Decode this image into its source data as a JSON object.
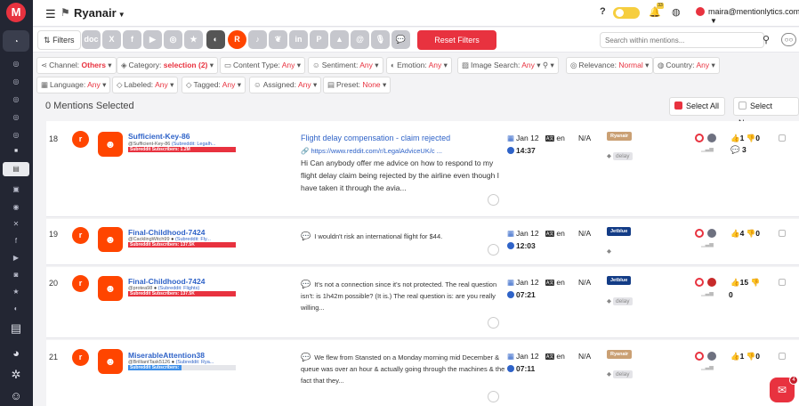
{
  "header": {
    "brand": "Ryanair",
    "help": "?",
    "bell_badge": "33",
    "user_email": "maira@mentionlytics.com"
  },
  "sidebar": {
    "logo": "M",
    "icons": [
      "dashboard-icon",
      "mentions-icon",
      "analytics-icon",
      "reports-icon",
      "chat-icon",
      "inbox-icon",
      "facebook-icon",
      "x-icon",
      "instagram-icon",
      "youtube-icon",
      "tiktok-icon",
      "star-icon",
      "contrast-icon",
      "document-icon",
      "pie-chart-icon",
      "settings-icon",
      "people-icon"
    ]
  },
  "toolbar": {
    "filters_label": "Filters",
    "reset_label": "Reset Filters",
    "search_placeholder": "Search within mentions...",
    "channels": [
      "doc",
      "X",
      "f",
      "▶",
      "◎",
      "★",
      "◐",
      "R",
      "♪",
      "❦",
      "in",
      "P",
      "▲",
      "@",
      "🎙",
      "💬"
    ]
  },
  "filters": {
    "row1": [
      {
        "key": "channel",
        "label": "Channel:",
        "value": "Others",
        "bold": true
      },
      {
        "key": "category",
        "label": "Category:",
        "value": "selection (2)",
        "bold": true
      },
      {
        "key": "content_type",
        "label": "Content Type:",
        "value": "Any"
      },
      {
        "key": "sentiment",
        "label": "Sentiment:",
        "value": "Any"
      },
      {
        "key": "emotion",
        "label": "Emotion:",
        "value": "Any"
      },
      {
        "key": "image_search",
        "label": "Image Search:",
        "value": "Any"
      },
      {
        "key": "relevance",
        "label": "Relevance:",
        "value": "Normal"
      },
      {
        "key": "country",
        "label": "Country:",
        "value": "Any"
      }
    ],
    "row2": [
      {
        "key": "language",
        "label": "Language:",
        "value": "Any"
      },
      {
        "key": "labeled",
        "label": "Labeled:",
        "value": "Any"
      },
      {
        "key": "tagged",
        "label": "Tagged:",
        "value": "Any"
      },
      {
        "key": "assigned",
        "label": "Assigned:",
        "value": "Any"
      },
      {
        "key": "preset",
        "label": "Preset:",
        "value": "None"
      }
    ]
  },
  "selection": {
    "count_text": "0 Mentions Selected",
    "select_all": "Select All",
    "select_none": "Select None"
  },
  "mentions": [
    {
      "num": "18",
      "username": "Sufficient-Key-86",
      "handle": "@Sufficient-Key-86",
      "subreddit": "(Subreddit: Legalh...",
      "subscribers": "Subreddit Subscribers: 1.2M",
      "title": "Flight delay compensation - claim rejected",
      "link": "https://www.reddit.com/r/LegalAdviceUK/c ...",
      "text": "Hi Can anybody offer me advice on how to respond to my flight delay claim being rejected by the airline even though I have taken it through the avia...",
      "date": "Jan 12",
      "time": "14:37",
      "lang": "en",
      "country": "N/A",
      "tag": "Ryanair",
      "keyword": "delay",
      "likes": "1",
      "dislikes": "0",
      "comments": "3"
    },
    {
      "num": "19",
      "username": "Final-Childhood-7424",
      "handle": "@CacklingWitch99",
      "subreddit": "(Subreddit: Fly...",
      "subscribers": "Subreddit Subscribers: 137.5K",
      "text": "I wouldn't risk an international flight for $44.",
      "date": "Jan 12",
      "time": "12:03",
      "lang": "en",
      "country": "N/A",
      "tag": "Jetblue",
      "likes": "4",
      "dislikes": "0"
    },
    {
      "num": "20",
      "username": "Final-Childhood-7424",
      "handle": "@protea98",
      "subreddit": "(Subreddit: Flights)",
      "subscribers": "Subreddit Subscribers: 137.5K",
      "text": "It's not a connection since it's not protected. The real question isn't: is 1h42m possible? (It is.) The real question is:  are you really willing...",
      "date": "Jan 12",
      "time": "07:21",
      "lang": "en",
      "country": "N/A",
      "tag": "Jetblue",
      "keyword": "delay",
      "likes": "15",
      "dislikes": "0"
    },
    {
      "num": "21",
      "username": "MiserableAttention38",
      "handle": "@BrilliantTask5126",
      "subreddit": "(Subreddit: Rya...",
      "subscribers": "Subreddit Subscribers:",
      "text": "We flew from Stansted on a Monday morning mid December & queue was over an hour & actually going through the machines & the fact that they...",
      "date": "Jan 12",
      "time": "07:11",
      "lang": "en",
      "country": "N/A",
      "tag": "Ryanair",
      "keyword": "delay",
      "likes": "1",
      "dislikes": "0"
    }
  ],
  "chat": {
    "badge": "4"
  }
}
